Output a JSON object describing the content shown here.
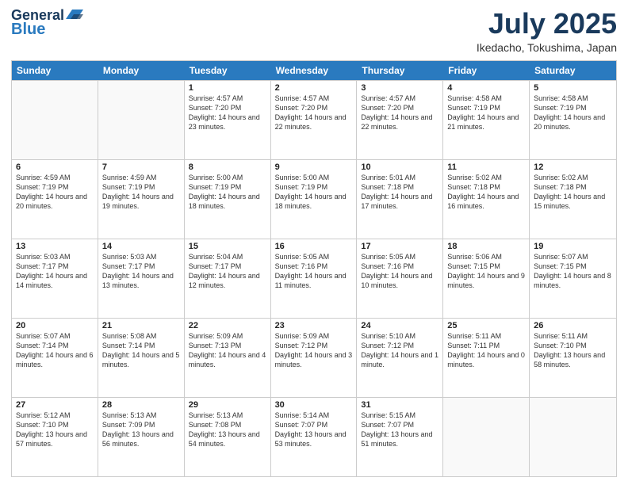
{
  "header": {
    "logo_general": "General",
    "logo_blue": "Blue",
    "month_year": "July 2025",
    "location": "Ikedacho, Tokushima, Japan"
  },
  "weekdays": [
    "Sunday",
    "Monday",
    "Tuesday",
    "Wednesday",
    "Thursday",
    "Friday",
    "Saturday"
  ],
  "rows": [
    [
      {
        "day": "",
        "sunrise": "",
        "sunset": "",
        "daylight": ""
      },
      {
        "day": "",
        "sunrise": "",
        "sunset": "",
        "daylight": ""
      },
      {
        "day": "1",
        "sunrise": "Sunrise: 4:57 AM",
        "sunset": "Sunset: 7:20 PM",
        "daylight": "Daylight: 14 hours and 23 minutes."
      },
      {
        "day": "2",
        "sunrise": "Sunrise: 4:57 AM",
        "sunset": "Sunset: 7:20 PM",
        "daylight": "Daylight: 14 hours and 22 minutes."
      },
      {
        "day": "3",
        "sunrise": "Sunrise: 4:57 AM",
        "sunset": "Sunset: 7:20 PM",
        "daylight": "Daylight: 14 hours and 22 minutes."
      },
      {
        "day": "4",
        "sunrise": "Sunrise: 4:58 AM",
        "sunset": "Sunset: 7:19 PM",
        "daylight": "Daylight: 14 hours and 21 minutes."
      },
      {
        "day": "5",
        "sunrise": "Sunrise: 4:58 AM",
        "sunset": "Sunset: 7:19 PM",
        "daylight": "Daylight: 14 hours and 20 minutes."
      }
    ],
    [
      {
        "day": "6",
        "sunrise": "Sunrise: 4:59 AM",
        "sunset": "Sunset: 7:19 PM",
        "daylight": "Daylight: 14 hours and 20 minutes."
      },
      {
        "day": "7",
        "sunrise": "Sunrise: 4:59 AM",
        "sunset": "Sunset: 7:19 PM",
        "daylight": "Daylight: 14 hours and 19 minutes."
      },
      {
        "day": "8",
        "sunrise": "Sunrise: 5:00 AM",
        "sunset": "Sunset: 7:19 PM",
        "daylight": "Daylight: 14 hours and 18 minutes."
      },
      {
        "day": "9",
        "sunrise": "Sunrise: 5:00 AM",
        "sunset": "Sunset: 7:19 PM",
        "daylight": "Daylight: 14 hours and 18 minutes."
      },
      {
        "day": "10",
        "sunrise": "Sunrise: 5:01 AM",
        "sunset": "Sunset: 7:18 PM",
        "daylight": "Daylight: 14 hours and 17 minutes."
      },
      {
        "day": "11",
        "sunrise": "Sunrise: 5:02 AM",
        "sunset": "Sunset: 7:18 PM",
        "daylight": "Daylight: 14 hours and 16 minutes."
      },
      {
        "day": "12",
        "sunrise": "Sunrise: 5:02 AM",
        "sunset": "Sunset: 7:18 PM",
        "daylight": "Daylight: 14 hours and 15 minutes."
      }
    ],
    [
      {
        "day": "13",
        "sunrise": "Sunrise: 5:03 AM",
        "sunset": "Sunset: 7:17 PM",
        "daylight": "Daylight: 14 hours and 14 minutes."
      },
      {
        "day": "14",
        "sunrise": "Sunrise: 5:03 AM",
        "sunset": "Sunset: 7:17 PM",
        "daylight": "Daylight: 14 hours and 13 minutes."
      },
      {
        "day": "15",
        "sunrise": "Sunrise: 5:04 AM",
        "sunset": "Sunset: 7:17 PM",
        "daylight": "Daylight: 14 hours and 12 minutes."
      },
      {
        "day": "16",
        "sunrise": "Sunrise: 5:05 AM",
        "sunset": "Sunset: 7:16 PM",
        "daylight": "Daylight: 14 hours and 11 minutes."
      },
      {
        "day": "17",
        "sunrise": "Sunrise: 5:05 AM",
        "sunset": "Sunset: 7:16 PM",
        "daylight": "Daylight: 14 hours and 10 minutes."
      },
      {
        "day": "18",
        "sunrise": "Sunrise: 5:06 AM",
        "sunset": "Sunset: 7:15 PM",
        "daylight": "Daylight: 14 hours and 9 minutes."
      },
      {
        "day": "19",
        "sunrise": "Sunrise: 5:07 AM",
        "sunset": "Sunset: 7:15 PM",
        "daylight": "Daylight: 14 hours and 8 minutes."
      }
    ],
    [
      {
        "day": "20",
        "sunrise": "Sunrise: 5:07 AM",
        "sunset": "Sunset: 7:14 PM",
        "daylight": "Daylight: 14 hours and 6 minutes."
      },
      {
        "day": "21",
        "sunrise": "Sunrise: 5:08 AM",
        "sunset": "Sunset: 7:14 PM",
        "daylight": "Daylight: 14 hours and 5 minutes."
      },
      {
        "day": "22",
        "sunrise": "Sunrise: 5:09 AM",
        "sunset": "Sunset: 7:13 PM",
        "daylight": "Daylight: 14 hours and 4 minutes."
      },
      {
        "day": "23",
        "sunrise": "Sunrise: 5:09 AM",
        "sunset": "Sunset: 7:12 PM",
        "daylight": "Daylight: 14 hours and 3 minutes."
      },
      {
        "day": "24",
        "sunrise": "Sunrise: 5:10 AM",
        "sunset": "Sunset: 7:12 PM",
        "daylight": "Daylight: 14 hours and 1 minute."
      },
      {
        "day": "25",
        "sunrise": "Sunrise: 5:11 AM",
        "sunset": "Sunset: 7:11 PM",
        "daylight": "Daylight: 14 hours and 0 minutes."
      },
      {
        "day": "26",
        "sunrise": "Sunrise: 5:11 AM",
        "sunset": "Sunset: 7:10 PM",
        "daylight": "Daylight: 13 hours and 58 minutes."
      }
    ],
    [
      {
        "day": "27",
        "sunrise": "Sunrise: 5:12 AM",
        "sunset": "Sunset: 7:10 PM",
        "daylight": "Daylight: 13 hours and 57 minutes."
      },
      {
        "day": "28",
        "sunrise": "Sunrise: 5:13 AM",
        "sunset": "Sunset: 7:09 PM",
        "daylight": "Daylight: 13 hours and 56 minutes."
      },
      {
        "day": "29",
        "sunrise": "Sunrise: 5:13 AM",
        "sunset": "Sunset: 7:08 PM",
        "daylight": "Daylight: 13 hours and 54 minutes."
      },
      {
        "day": "30",
        "sunrise": "Sunrise: 5:14 AM",
        "sunset": "Sunset: 7:07 PM",
        "daylight": "Daylight: 13 hours and 53 minutes."
      },
      {
        "day": "31",
        "sunrise": "Sunrise: 5:15 AM",
        "sunset": "Sunset: 7:07 PM",
        "daylight": "Daylight: 13 hours and 51 minutes."
      },
      {
        "day": "",
        "sunrise": "",
        "sunset": "",
        "daylight": ""
      },
      {
        "day": "",
        "sunrise": "",
        "sunset": "",
        "daylight": ""
      }
    ]
  ]
}
